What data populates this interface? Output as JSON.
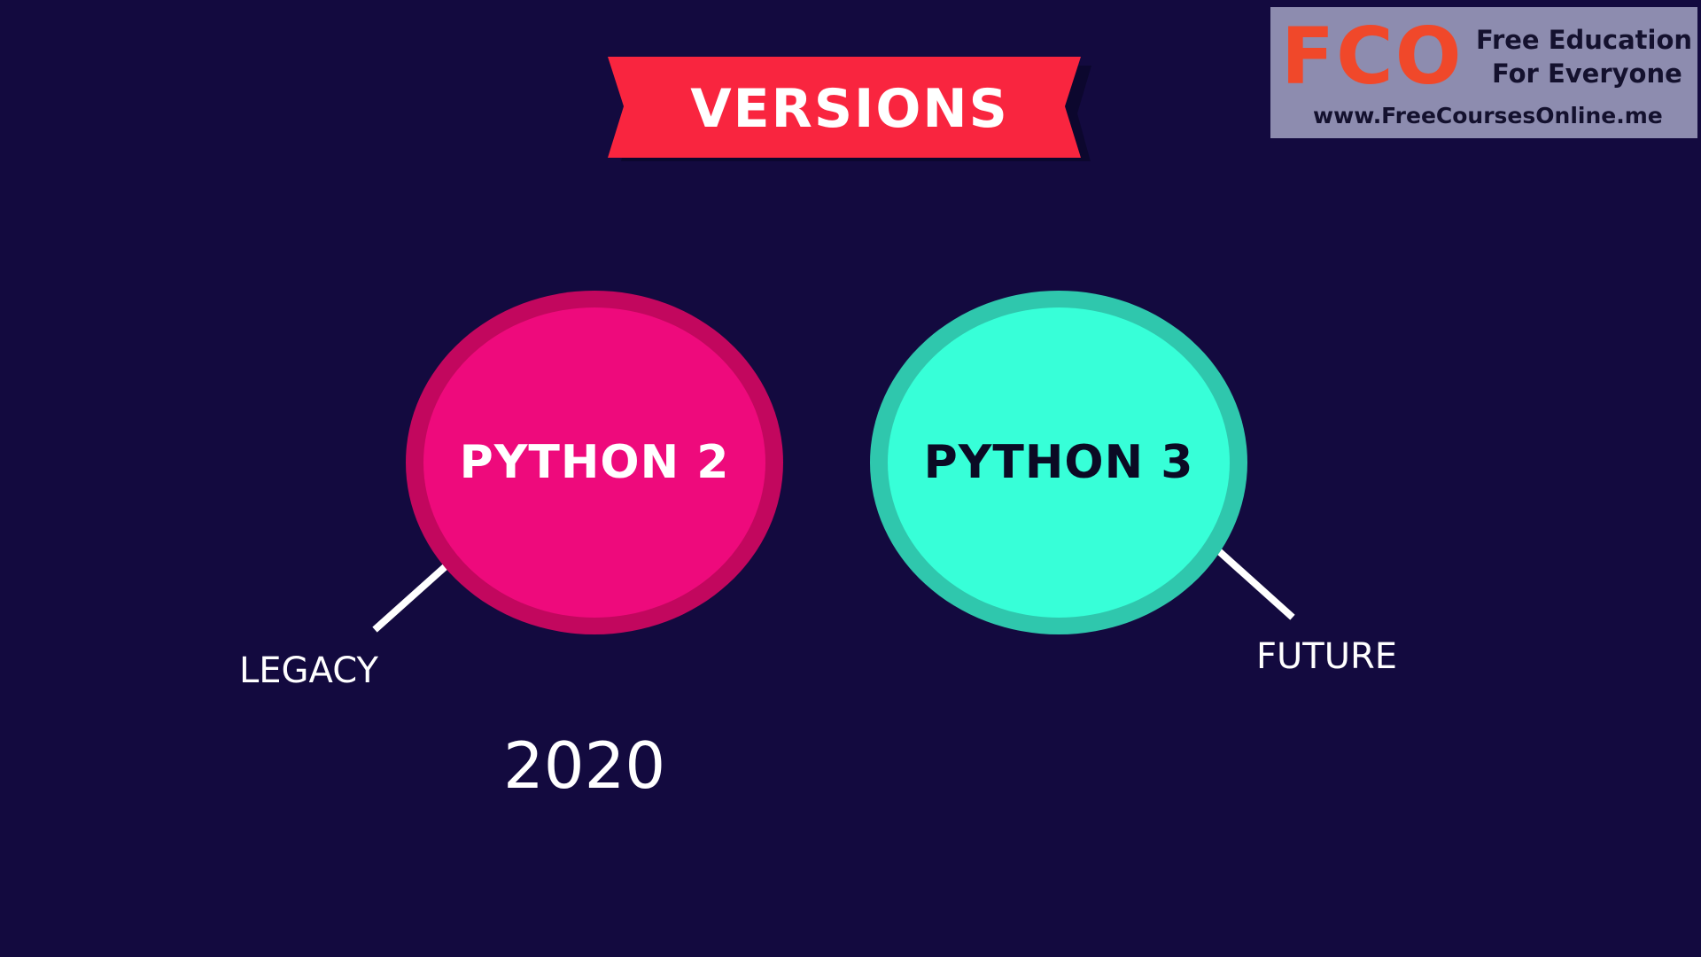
{
  "title": {
    "label": "VERSIONS"
  },
  "watermark": {
    "mark": "FCO",
    "line1": "Free Education",
    "line2": "For Everyone",
    "url": "www.FreeCoursesOnline.me"
  },
  "versions": [
    {
      "label": "PYTHON 2",
      "caption": "LEGACY",
      "year": "2020",
      "color": "#ee0a7c",
      "ring_color": "#c2075e"
    },
    {
      "label": "PYTHON 3",
      "caption": "FUTURE",
      "color": "#37ffd8",
      "ring_color": "#2fc7ad"
    }
  ],
  "colors": {
    "background": "#130a3f",
    "banner": "#f9253f",
    "banner_shadow": "#0a0628",
    "logo_background": "#8d8caf",
    "logo_mark": "#f0482a"
  }
}
